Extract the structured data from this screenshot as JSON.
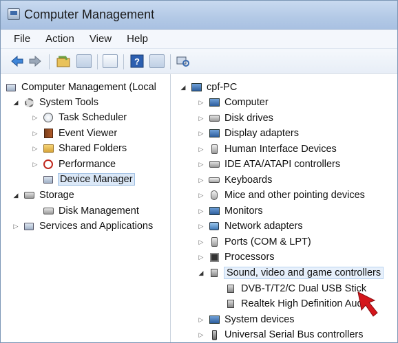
{
  "window": {
    "title": "Computer Management"
  },
  "menu": [
    "File",
    "Action",
    "View",
    "Help"
  ],
  "toolbar": {
    "buttons": [
      "back-arrow",
      "forward-arrow",
      "up-folder",
      "show-hide-console-tree",
      "properties",
      "help",
      "show-action-pane",
      "scan-hardware"
    ]
  },
  "left_tree": {
    "root": "Computer Management (Local",
    "system_tools": "System Tools",
    "task_scheduler": "Task Scheduler",
    "event_viewer": "Event Viewer",
    "shared_folders": "Shared Folders",
    "performance": "Performance",
    "device_manager": "Device Manager",
    "storage": "Storage",
    "disk_management": "Disk Management",
    "services_apps": "Services and Applications"
  },
  "right_tree": {
    "root": "cpf-PC",
    "items": [
      "Computer",
      "Disk drives",
      "Display adapters",
      "Human Interface Devices",
      "IDE ATA/ATAPI controllers",
      "Keyboards",
      "Mice and other pointing devices",
      "Monitors",
      "Network adapters",
      "Ports (COM & LPT)",
      "Processors",
      "Sound, video and game controllers",
      "DVB-T/T2/C Dual USB Stick",
      "Realtek High Definition Audio",
      "System devices",
      "Universal Serial Bus controllers"
    ]
  },
  "colors": {
    "accent": "#d4161b",
    "title_bar": "#b3c9e6",
    "selection": "#dbe8f7"
  }
}
